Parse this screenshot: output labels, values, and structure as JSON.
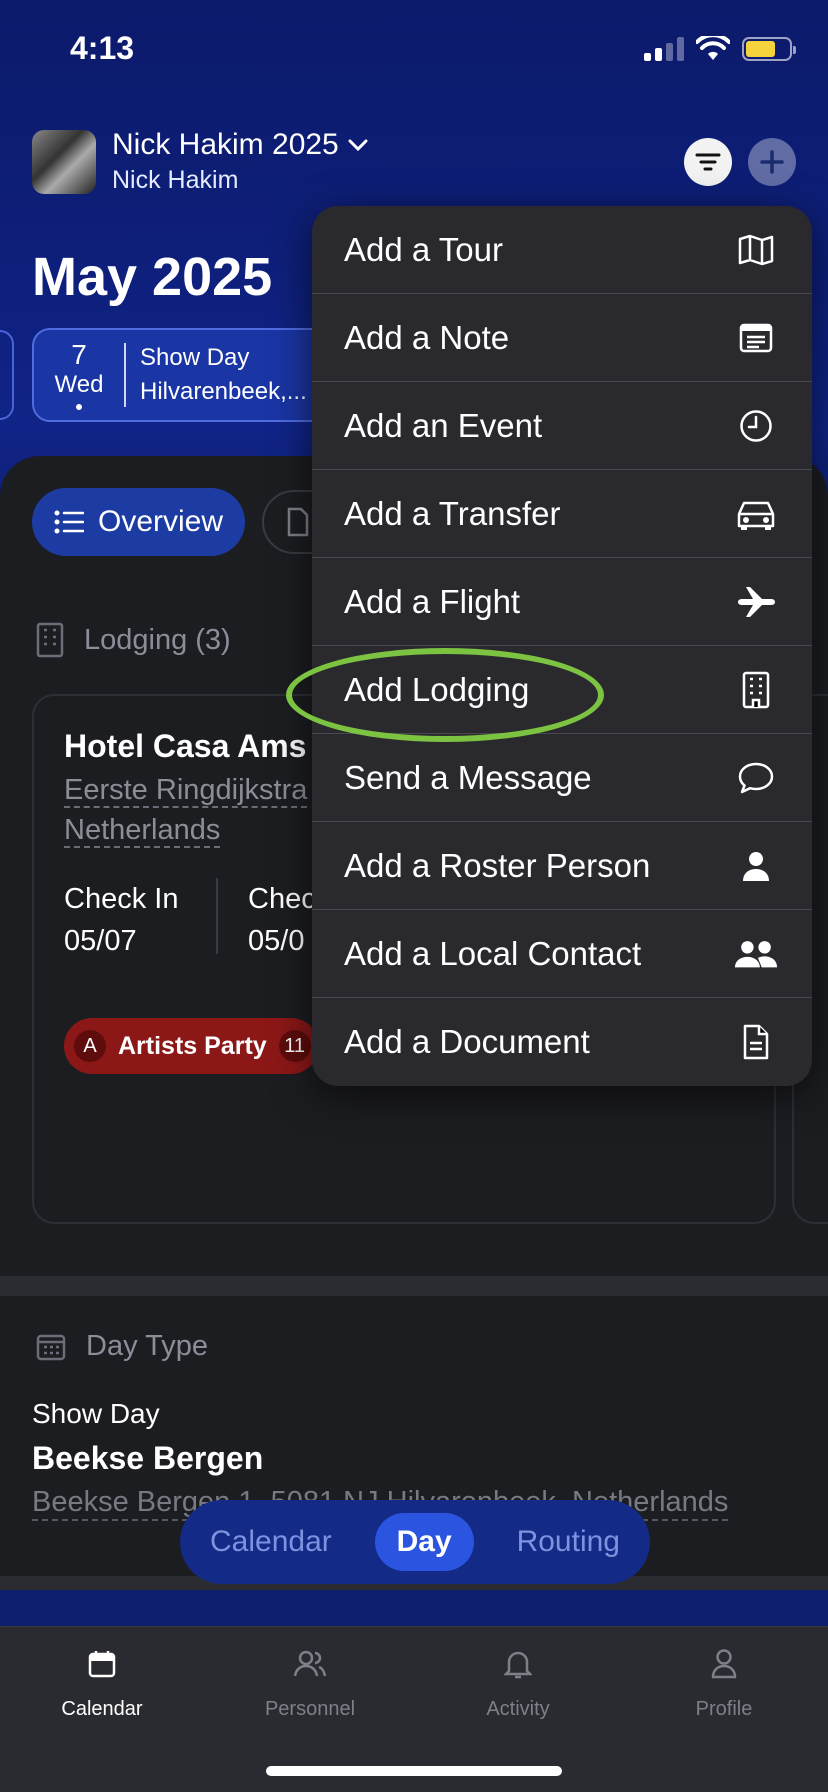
{
  "status": {
    "time": "4:13"
  },
  "header": {
    "tour_name": "Nick Hakim 2025",
    "artist": "Nick Hakim",
    "month_title": "May 2025"
  },
  "date_card": {
    "day": "7",
    "weekday": "Wed",
    "title": "Show Day",
    "location": "Hilvarenbeek,..."
  },
  "tabs": {
    "overview": "Overview"
  },
  "lodging": {
    "header": "Lodging (3)",
    "hotel_name": "Hotel Casa Ams",
    "address_line1": "Eerste Ringdijkstra",
    "address_line2": "Netherlands",
    "check_in_label": "Check In",
    "check_in_date": "05/07",
    "check_out_label": "Chec",
    "check_out_date": "05/0",
    "tag_initial": "A",
    "tag_label": "Artists Party",
    "tag_count": "11"
  },
  "day_type": {
    "header": "Day Type",
    "label": "Show Day",
    "venue": "Beekse Bergen",
    "address": "Beekse Bergen 1, 5081 NJ Hilvarenbeek, Netherlands"
  },
  "segmented": {
    "calendar": "Calendar",
    "day": "Day",
    "routing": "Routing"
  },
  "menu": {
    "items": [
      {
        "label": "Add a Tour",
        "icon": "map-icon"
      },
      {
        "label": "Add a Note",
        "icon": "note-icon"
      },
      {
        "label": "Add an Event",
        "icon": "clock-icon"
      },
      {
        "label": "Add a Transfer",
        "icon": "car-icon"
      },
      {
        "label": "Add a Flight",
        "icon": "airplane-icon"
      },
      {
        "label": "Add Lodging",
        "icon": "building-icon"
      },
      {
        "label": "Send a Message",
        "icon": "chat-bubble-icon"
      },
      {
        "label": "Add a Roster Person",
        "icon": "person-icon"
      },
      {
        "label": "Add a Local Contact",
        "icon": "people-icon"
      },
      {
        "label": "Add a Document",
        "icon": "document-icon"
      }
    ]
  },
  "tabbar": {
    "calendar": "Calendar",
    "personnel": "Personnel",
    "activity": "Activity",
    "profile": "Profile"
  },
  "colors": {
    "accent": "#2b55e0",
    "highlight": "#7dc342",
    "tag": "#8c1717"
  }
}
